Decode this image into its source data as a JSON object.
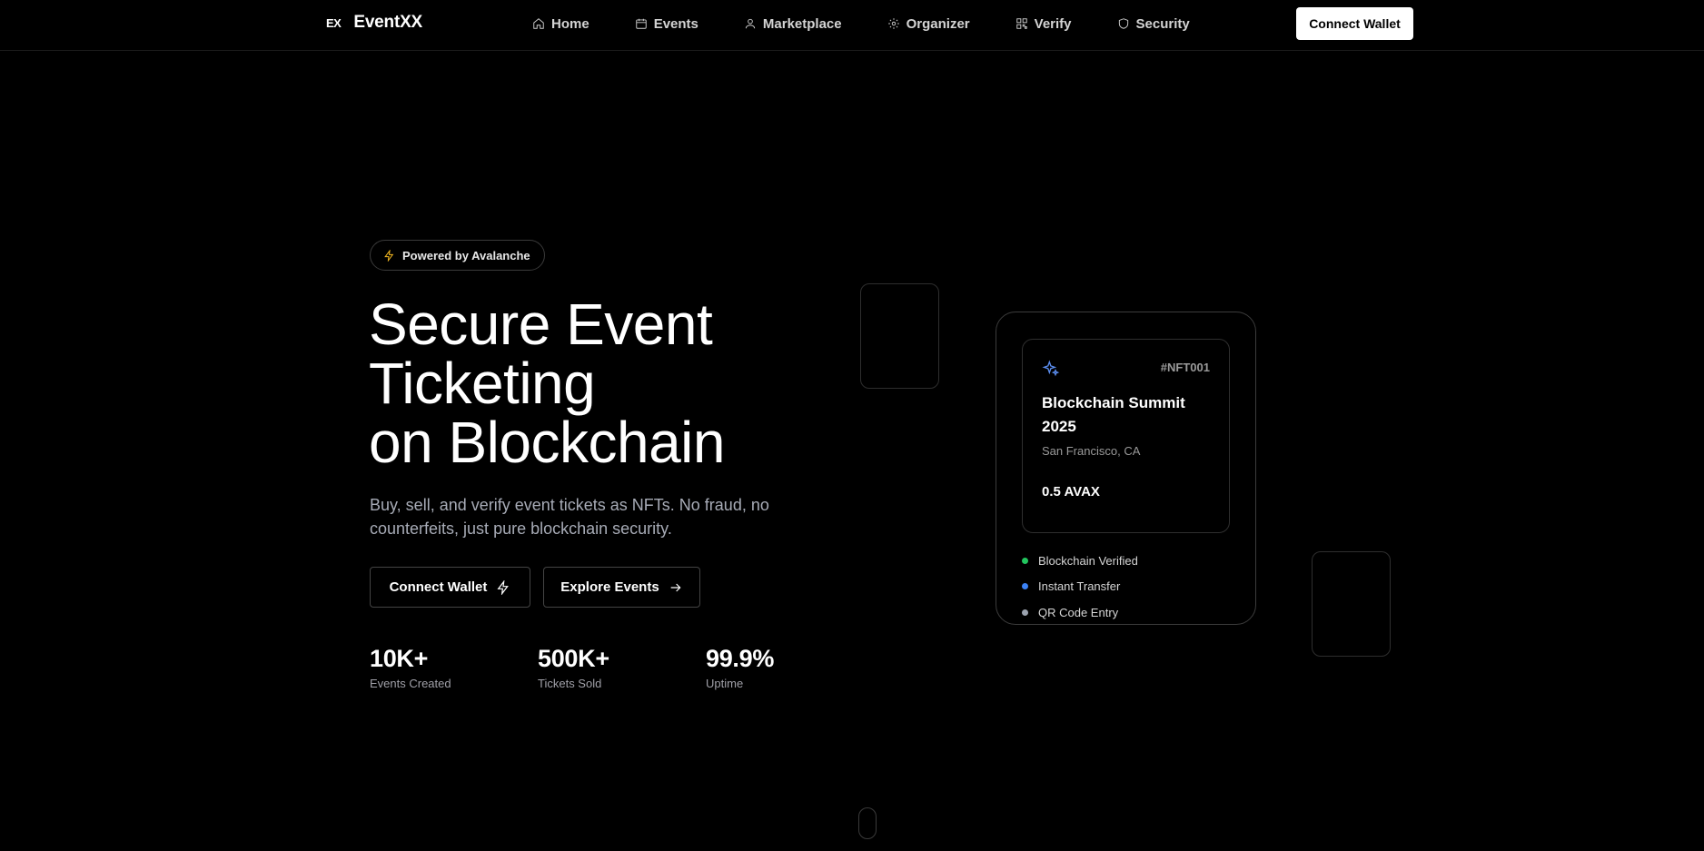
{
  "brand": {
    "mark": "EX",
    "name": "EventXX"
  },
  "nav": {
    "items": [
      {
        "label": "Home",
        "icon": "home-icon"
      },
      {
        "label": "Events",
        "icon": "calendar-icon"
      },
      {
        "label": "Marketplace",
        "icon": "user-icon"
      },
      {
        "label": "Organizer",
        "icon": "gear-icon"
      },
      {
        "label": "Verify",
        "icon": "qr-code-icon"
      },
      {
        "label": "Security",
        "icon": "shield-icon"
      }
    ],
    "connect_label": "Connect Wallet"
  },
  "hero": {
    "badge": "Powered by Avalanche",
    "title_lines": [
      "Secure Event",
      "Ticketing",
      "on Blockchain"
    ],
    "subtitle": "Buy, sell, and verify event tickets as NFTs. No fraud, no counterfeits, just pure blockchain security.",
    "connect_label": "Connect Wallet",
    "explore_label": "Explore Events"
  },
  "stats": [
    {
      "value": "10K+",
      "label": "Events Created"
    },
    {
      "value": "500K+",
      "label": "Tickets Sold"
    },
    {
      "value": "99.9%",
      "label": "Uptime"
    }
  ],
  "ticket": {
    "nft_id": "#NFT001",
    "event_name": "Blockchain Summit 2025",
    "location": "San Francisco, CA",
    "price": "0.5 AVAX",
    "features": [
      {
        "label": "Blockchain Verified",
        "color": "#22c55e"
      },
      {
        "label": "Instant Transfer",
        "color": "#3b82f6"
      },
      {
        "label": "QR Code Entry",
        "color": "#9ca3af"
      }
    ]
  },
  "colors": {
    "background": "#000000",
    "accent_badge": "#f5b921",
    "sparkle": "#5b8def"
  }
}
